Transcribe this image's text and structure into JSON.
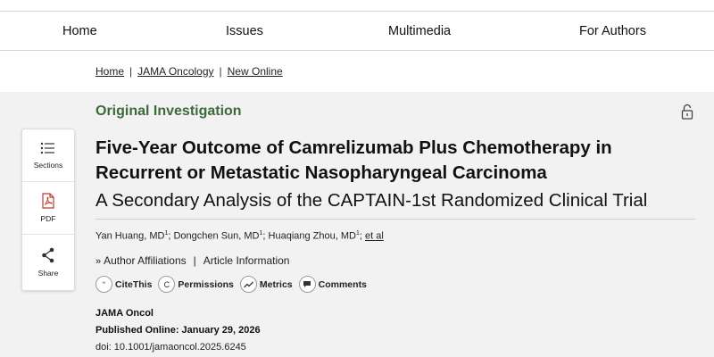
{
  "nav": {
    "items": [
      {
        "label": "Home"
      },
      {
        "label": "Issues"
      },
      {
        "label": "Multimedia"
      },
      {
        "label": "For Authors"
      }
    ]
  },
  "breadcrumb": {
    "items": [
      {
        "label": "Home"
      },
      {
        "label": "JAMA Oncology"
      },
      {
        "label": "New Online"
      }
    ],
    "separator": "|"
  },
  "sidebar": {
    "sections_label": "Sections",
    "pdf_label": "PDF",
    "share_label": "Share"
  },
  "article": {
    "category": "Original Investigation",
    "title": "Five-Year Outcome of Camrelizumab Plus Chemotherapy in Recurrent or Metastatic Nasopharyngeal Carcinoma",
    "subtitle": "A Secondary Analysis of the CAPTAIN-1st Randomized Clinical Trial",
    "authors": [
      {
        "name": "Yan Huang, MD",
        "affil": "1"
      },
      {
        "name": "Dongchen Sun, MD",
        "affil": "1"
      },
      {
        "name": "Huaqiang Zhou, MD",
        "affil": "1"
      }
    ],
    "et_al": "et al",
    "author_affiliations": "Author Affiliations",
    "article_information": "Article Information",
    "actions": [
      {
        "label": "CiteThis",
        "icon": "quote-icon",
        "glyph": "“"
      },
      {
        "label": "Permissions",
        "icon": "copyright-icon",
        "glyph": "C"
      },
      {
        "label": "Metrics",
        "icon": "trend-icon",
        "glyph": ""
      },
      {
        "label": "Comments",
        "icon": "comment-icon",
        "glyph": ""
      }
    ],
    "journal": "JAMA Oncol",
    "published": "Published Online: January 29, 2026",
    "doi": "doi: 10.1001/jamaoncol.2025.6245"
  },
  "colors": {
    "category_green": "#3d6a39",
    "panel_gray": "#f2f2f2",
    "pdf_red": "#c0392b"
  }
}
